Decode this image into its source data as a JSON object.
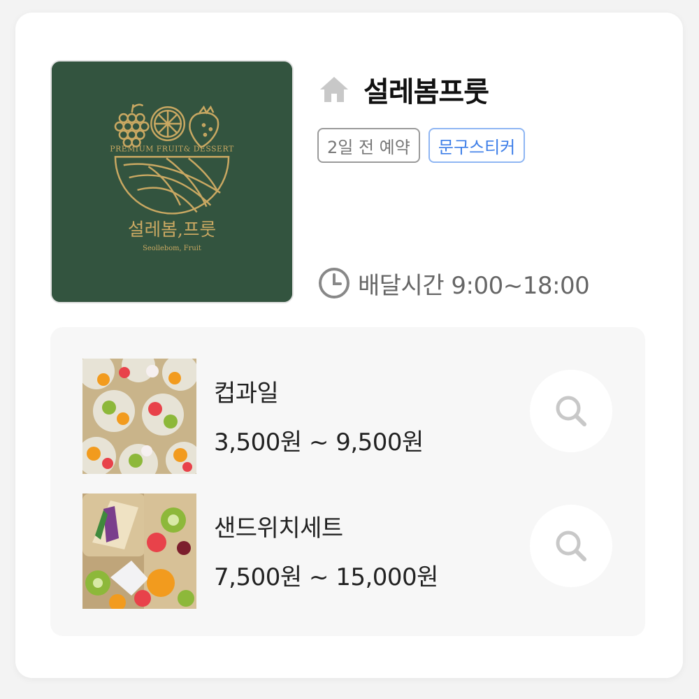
{
  "store": {
    "name": "설레봄프룻",
    "logo": {
      "tagline": "PREMIUM FRUIT& DESSERT",
      "name_ko": "설레봄,프룻",
      "name_en": "Seollebom, Fruit",
      "bg_color": "#33543f",
      "gold_color": "#c9a862"
    },
    "tags": [
      {
        "label": "2일 전 예약",
        "style": "gray"
      },
      {
        "label": "문구스티커",
        "style": "blue"
      }
    ],
    "delivery": {
      "label": "배달시간 9:00~18:00"
    }
  },
  "menu": {
    "items": [
      {
        "name": "컵과일",
        "price": "3,500원 ~ 9,500원",
        "image": "cup-fruit-photo"
      },
      {
        "name": "샌드위치세트",
        "price": "7,500원 ~ 15,000원",
        "image": "sandwich-set-photo"
      }
    ]
  },
  "icons": {
    "home": "home-icon",
    "clock": "clock-icon",
    "search": "search-icon"
  },
  "colors": {
    "accent_blue": "#3d7ee8",
    "panel_bg": "#f7f7f7",
    "icon_gray": "#c8c8c8"
  }
}
